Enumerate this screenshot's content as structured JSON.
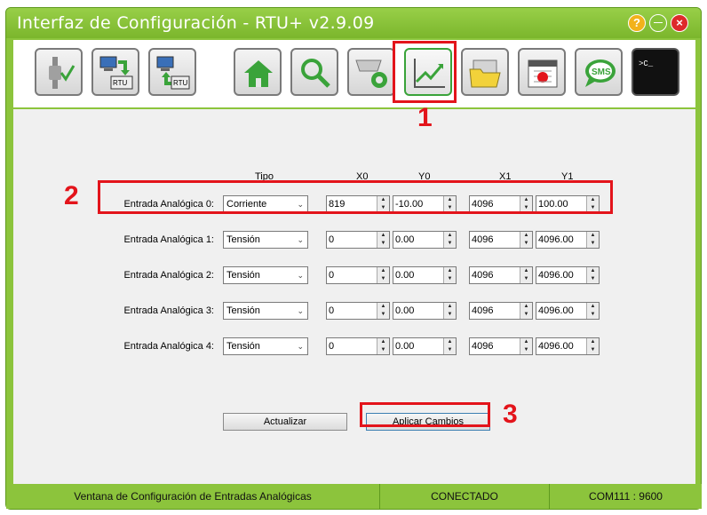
{
  "window": {
    "title": "Interfaz de Configuración - RTU+ v2.9.09",
    "help_glyph": "?",
    "minimize_glyph": "—",
    "close_glyph": "×"
  },
  "toolbar": {
    "icons": [
      "disconnect-check-icon",
      "download-from-rtu-icon",
      "upload-to-rtu-icon",
      "home-icon",
      "search-icon",
      "serial-port-settings-icon",
      "analog-chart-icon",
      "open-folder-icon",
      "calendar-icon",
      "sms-icon",
      "terminal-icon"
    ],
    "rtu_label": "RTU",
    "sms_label": "SMS",
    "terminal_text": ">C_"
  },
  "table": {
    "headers": {
      "tipo": "Tipo",
      "x0": "X0",
      "y0": "Y0",
      "x1": "X1",
      "y1": "Y1"
    },
    "rows": [
      {
        "label": "Entrada Analógica 0:",
        "tipo": "Corriente",
        "x0": "819",
        "y0": "-10.00",
        "x1": "4096",
        "y1": "100.00"
      },
      {
        "label": "Entrada Analógica 1:",
        "tipo": "Tensión",
        "x0": "0",
        "y0": "0.00",
        "x1": "4096",
        "y1": "4096.00"
      },
      {
        "label": "Entrada Analógica 2:",
        "tipo": "Tensión",
        "x0": "0",
        "y0": "0.00",
        "x1": "4096",
        "y1": "4096.00"
      },
      {
        "label": "Entrada Analógica 3:",
        "tipo": "Tensión",
        "x0": "0",
        "y0": "0.00",
        "x1": "4096",
        "y1": "4096.00"
      },
      {
        "label": "Entrada Analógica 4:",
        "tipo": "Tensión",
        "x0": "0",
        "y0": "0.00",
        "x1": "4096",
        "y1": "4096.00"
      }
    ]
  },
  "buttons": {
    "refresh": "Actualizar",
    "apply": "Aplicar Cambios"
  },
  "annotations": {
    "n1": "1",
    "n2": "2",
    "n3": "3"
  },
  "status": {
    "window_name": "Ventana de Configuración de Entradas Analógicas",
    "connection": "CONECTADO",
    "port": "COM111 : 9600"
  },
  "colors": {
    "accent": "#8cc43c",
    "annotation": "#e3141b"
  }
}
